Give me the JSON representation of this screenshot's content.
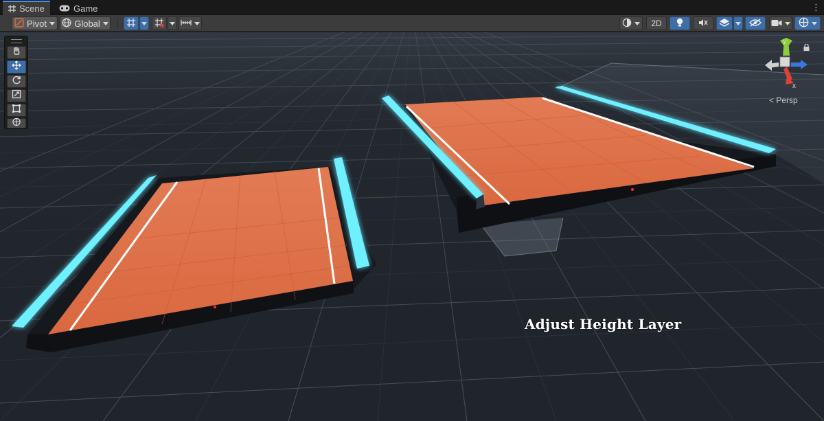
{
  "tabs": [
    {
      "label": "Scene",
      "icon": "grid-icon",
      "active": true
    },
    {
      "label": "Game",
      "icon": "gamepad-icon",
      "active": false
    }
  ],
  "toolbar": {
    "pivot_label": "Pivot",
    "global_label": "Global",
    "mode_2d_label": "2D"
  },
  "tools": [
    "hand-tool",
    "move-tool",
    "rotate-tool",
    "scale-tool",
    "rect-tool",
    "transform-tool"
  ],
  "active_tool": "move-tool",
  "gizmo": {
    "y_label": "y",
    "x_label": "x",
    "projection_label": "Persp"
  },
  "caption": "Adjust Height Layer",
  "colors": {
    "accent": "#3f6ea6",
    "court": "#e07852",
    "glow": "#5fe6ff",
    "grid_bg": "#22272e",
    "axis_y": "#8ccd3c",
    "axis_x": "#e0403a",
    "axis_z": "#3a78e0"
  }
}
